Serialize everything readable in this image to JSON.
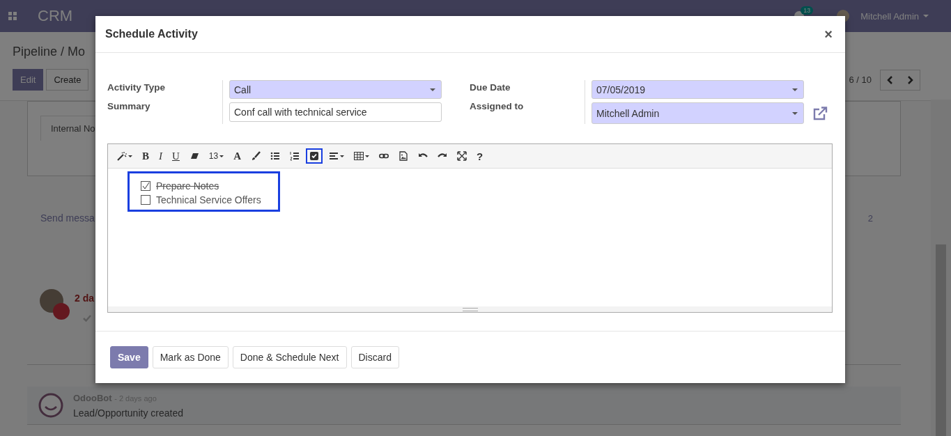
{
  "navbar": {
    "app_name": "CRM",
    "chat_count": "13",
    "user": "Mitchell Admin"
  },
  "control_panel": {
    "breadcrumb": "Pipeline / Mo",
    "buttons": [
      {
        "label": "Edit",
        "primary": true
      },
      {
        "label": "Create",
        "primary": false
      }
    ],
    "pager": "6 / 10"
  },
  "sheet": {
    "tab": "Internal No"
  },
  "chatter": {
    "send_message": "Send messa",
    "followers": "2",
    "activity_due": "2 da",
    "message": {
      "author": "OdooBot",
      "time": "- 2 days ago",
      "body": "Lead/Opportunity created"
    }
  },
  "dialog": {
    "title": "Schedule Activity",
    "close": "×",
    "field_groups": [
      [
        {
          "label": "Activity Type",
          "kind": "select",
          "value": "Call",
          "external_link": false
        },
        {
          "label": "Summary",
          "kind": "text",
          "value": "Conf call with technical service",
          "external_link": false
        }
      ],
      [
        {
          "label": "Due Date",
          "kind": "select",
          "value": "07/05/2019",
          "external_link": false
        },
        {
          "label": "Assigned to",
          "kind": "select",
          "value": "Mitchell Admin",
          "external_link": true
        }
      ]
    ],
    "toolbar": [
      {
        "kind": "icon",
        "dropdown": true,
        "highlighted": false
      },
      {
        "kind": "text",
        "label": "B",
        "dropdown": false,
        "highlighted": false
      },
      {
        "kind": "text",
        "label": "I",
        "dropdown": false,
        "highlighted": false
      },
      {
        "kind": "text",
        "label": "U",
        "dropdown": false,
        "highlighted": false
      },
      {
        "kind": "icon",
        "dropdown": false,
        "highlighted": false
      },
      {
        "kind": "text",
        "label": "13",
        "dropdown": true,
        "highlighted": false
      },
      {
        "kind": "text",
        "label": "A",
        "dropdown": false,
        "highlighted": false
      },
      {
        "kind": "icon",
        "dropdown": false,
        "highlighted": false
      },
      {
        "kind": "icon",
        "dropdown": false,
        "highlighted": false
      },
      {
        "kind": "icon",
        "dropdown": false,
        "highlighted": false
      },
      {
        "kind": "icon",
        "dropdown": false,
        "highlighted": true
      },
      {
        "kind": "icon",
        "dropdown": true,
        "highlighted": false
      },
      {
        "kind": "icon",
        "dropdown": true,
        "highlighted": false
      },
      {
        "kind": "icon",
        "dropdown": false,
        "highlighted": false
      },
      {
        "kind": "icon",
        "dropdown": false,
        "highlighted": false
      },
      {
        "kind": "icon",
        "dropdown": false,
        "highlighted": false
      },
      {
        "kind": "icon",
        "dropdown": false,
        "highlighted": false
      },
      {
        "kind": "icon",
        "dropdown": false,
        "highlighted": false
      },
      {
        "kind": "text",
        "label": "?",
        "dropdown": false,
        "highlighted": false
      }
    ],
    "checklist_highlighted": true,
    "checklist": [
      {
        "text": "Prepare Notes",
        "checked": true
      },
      {
        "text": "Technical Service Offers",
        "checked": false
      }
    ],
    "buttons": [
      {
        "label": "Save",
        "primary": true
      },
      {
        "label": "Mark as Done",
        "primary": false
      },
      {
        "label": "Done & Schedule Next",
        "primary": false
      },
      {
        "label": "Discard",
        "primary": false
      }
    ]
  }
}
